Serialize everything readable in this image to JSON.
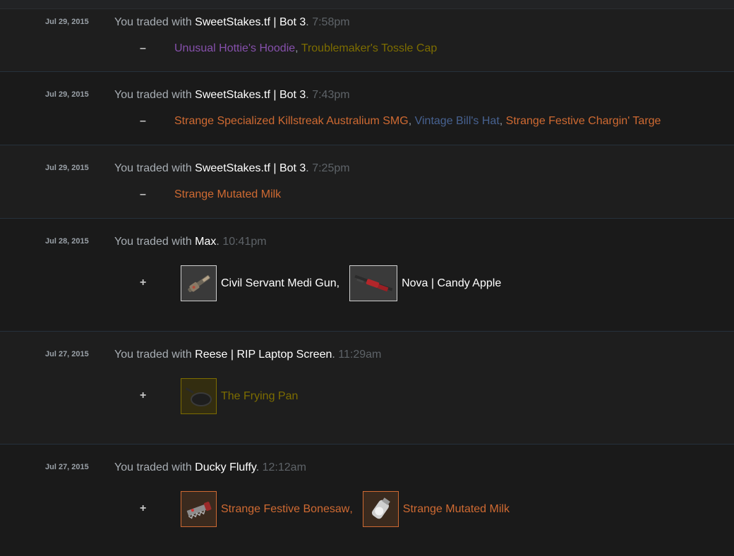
{
  "trades": [
    {
      "date": "Jul 29, 2015",
      "prefix": "You traded with",
      "partner": "SweetStakes.tf | Bot 3",
      "time": "7:58pm",
      "sign": "–",
      "items": [
        {
          "name": "Unusual Hottie's Hoodie",
          "quality_color": "#8650ac"
        },
        {
          "name": "Troublemaker's Tossle Cap",
          "quality_color": "#7d6d00"
        }
      ]
    },
    {
      "date": "Jul 29, 2015",
      "prefix": "You traded with",
      "partner": "SweetStakes.tf | Bot 3",
      "time": "7:43pm",
      "sign": "–",
      "items": [
        {
          "name": "Strange Specialized Killstreak Australium SMG",
          "quality_color": "#cf6a32"
        },
        {
          "name": "Vintage Bill's Hat",
          "quality_color": "#476291"
        },
        {
          "name": "Strange Festive Chargin' Targe",
          "quality_color": "#cf6a32"
        }
      ]
    },
    {
      "date": "Jul 29, 2015",
      "prefix": "You traded with",
      "partner": "SweetStakes.tf | Bot 3",
      "time": "7:25pm",
      "sign": "–",
      "items": [
        {
          "name": "Strange Mutated Milk",
          "quality_color": "#cf6a32"
        }
      ]
    },
    {
      "date": "Jul 28, 2015",
      "prefix": "You traded with",
      "partner": "Max",
      "time": "10:41pm",
      "sign": "+",
      "items": [
        {
          "name": "Civil Servant Medi Gun",
          "icon": "medigun-icon",
          "quality_color": "#ffffff"
        },
        {
          "name": "Nova | Candy Apple",
          "icon": "shotgun-icon",
          "quality_color": "#ffffff"
        }
      ]
    },
    {
      "date": "Jul 27, 2015",
      "prefix": "You traded with",
      "partner": "Reese | RIP Laptop Screen",
      "time": "11:29am",
      "sign": "+",
      "items": [
        {
          "name": "The Frying Pan",
          "icon": "frying-pan-icon",
          "quality_color": "#7d6d00"
        }
      ]
    },
    {
      "date": "Jul 27, 2015",
      "prefix": "You traded with",
      "partner": "Ducky Fluffy",
      "time": "12:12am",
      "sign": "+",
      "items": [
        {
          "name": "Strange Festive Bonesaw",
          "icon": "bonesaw-icon",
          "quality_color": "#cf6a32"
        },
        {
          "name": "Strange Mutated Milk",
          "icon": "milk-jar-icon",
          "quality_color": "#cf6a32"
        }
      ]
    }
  ],
  "punctuation": {
    "period": ".",
    "comma": ","
  }
}
